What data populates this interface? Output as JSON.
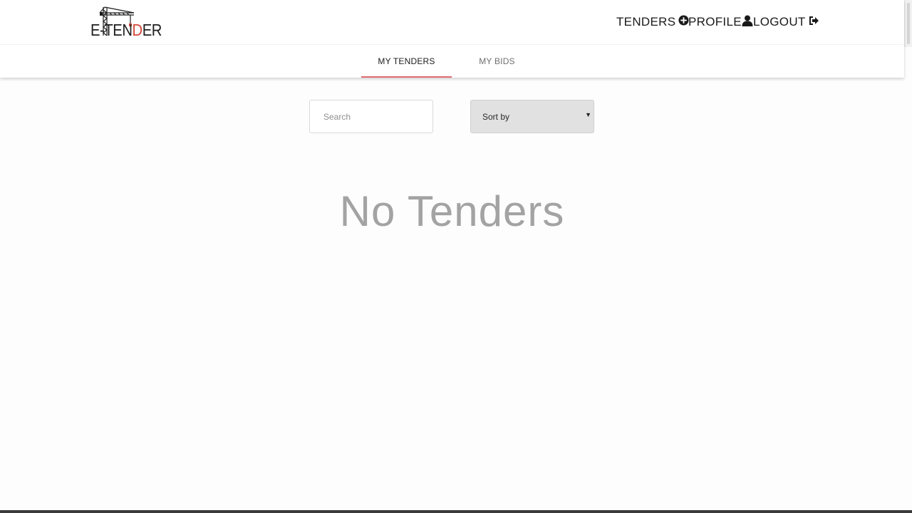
{
  "brand": {
    "logo_prefix": "E-",
    "logo_t": "T",
    "logo_en": "EN",
    "logo_d": "D",
    "logo_er": "ER",
    "accent_color": "#d3473a"
  },
  "nav": {
    "tenders_label": "TENDERS",
    "tenders_icon": "plus-circle-icon",
    "profile_label": "PROFILE",
    "profile_icon": "user-icon",
    "logout_label": "LOGOUT",
    "logout_icon": "sign-out-icon"
  },
  "tabs": [
    {
      "label": "MY TENDERS",
      "active": true
    },
    {
      "label": "MY BIDS",
      "active": false
    }
  ],
  "tab_indicator_color": "#e06a72",
  "search": {
    "placeholder": "Search",
    "value": ""
  },
  "sort": {
    "label": "Sort by",
    "arrow_icon": "triangle-down-icon"
  },
  "empty_state": {
    "title": "No Tenders"
  }
}
